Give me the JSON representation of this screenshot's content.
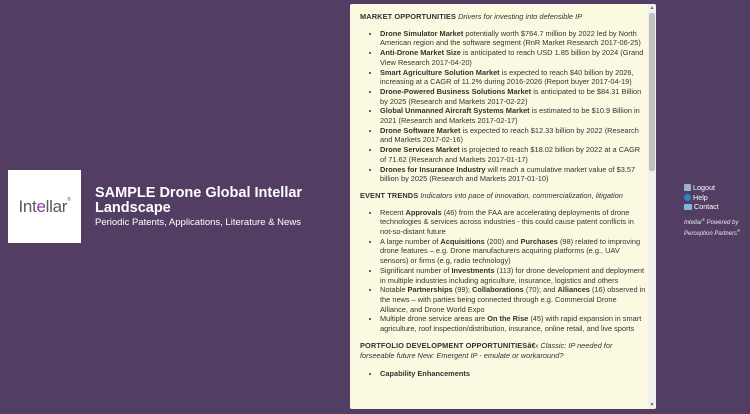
{
  "brand": {
    "logo_prefix": "Int",
    "logo_o": "e",
    "logo_suffix": "llar",
    "logo_mark": "®"
  },
  "header": {
    "title": "SAMPLE Drone Global Intellar Landscape",
    "subtitle": "Periodic Patents, Applications, Literature & News"
  },
  "panel": {
    "sections": [
      {
        "title": "MARKET OPPORTUNITIES",
        "subtitle": "Drivers for investing into defensible IP",
        "items": [
          {
            "bold": "Drone Simulator Market",
            "rest": " potentially worth $764.7 million by 2022 led by North American region and the software segment (RnR Market Research 2017-06-25)"
          },
          {
            "bold": "Anti-Drone Market Size",
            "rest": " is anticipated to reach USD 1.85 billion by 2024 (Grand View Research 2017-04-20)"
          },
          {
            "bold": "Smart Agriculture Solution Market",
            "rest": " is expected to reach $40 billion by 2026, increasing at a CAGR of 11.2% during 2016-2026 (Report buyer 2017-04-19)"
          },
          {
            "bold": "Drone-Powered Business Solutions Market",
            "rest": " is anticipated to be $84.31 Billion by 2025 (Research and Markets 2017-02-22)"
          },
          {
            "bold": "Global Unmanned Aircraft Systems Market",
            "rest": " is estimated to be $10.9 Billion in 2021 (Research and Markets 2017-02-17)"
          },
          {
            "bold": "Drone Software Market",
            "rest": " is expected to reach $12.33 billion by 2022 (Research and Markets 2017-02-16)"
          },
          {
            "bold": "Drone Services Market",
            "rest": " is projected to reach $18.02 billion by 2022 at a CAGR of 71.62 (Research and Markets 2017-01-17)"
          },
          {
            "bold": "Drones for Insurance Industry",
            "rest": " will reach a cumulative market value of $3.57 billion by 2025 (Research and Markets 2017-01-10)"
          }
        ]
      },
      {
        "title": "EVENT TRENDS",
        "subtitle": "Indicators into pace of innovation, commercialization, litigation",
        "items": [
          {
            "parts": [
              [
                "",
                "Recent "
              ],
              [
                "b",
                "Approvals"
              ],
              [
                "",
                " (46) from the FAA are accelerating deployments of drone technologies & services across industries - this could cause patent conflicts in not-so-distant future"
              ]
            ]
          },
          {
            "parts": [
              [
                "",
                "A large number of "
              ],
              [
                "b",
                "Acquisitions"
              ],
              [
                "",
                " (200) and "
              ],
              [
                "b",
                "Purchases"
              ],
              [
                "",
                " (98) related to improving drone features – e.g. Drone manufacturers acquiring platforms (e.g., UAV sensors) or firms (e.g, radio technology)"
              ]
            ]
          },
          {
            "parts": [
              [
                "",
                "Significant number of "
              ],
              [
                "b",
                "Investments"
              ],
              [
                "",
                " (113) for drone development and deployment in multiple industries including agriculture, insurance, logistics and others"
              ]
            ]
          },
          {
            "parts": [
              [
                "",
                "Notable "
              ],
              [
                "b",
                "Partnerships"
              ],
              [
                "",
                " (99); "
              ],
              [
                "b",
                "Collaborations"
              ],
              [
                "",
                " (70); and "
              ],
              [
                "b",
                "Alliances"
              ],
              [
                "",
                " (16) observed in the news – with parties being connected through e.g. Commercial Drone Alliance, and Drone World Expo"
              ]
            ]
          },
          {
            "parts": [
              [
                "",
                "Multiple drone service areas are "
              ],
              [
                "b",
                "On the Rise"
              ],
              [
                "",
                " (45) with rapid expansion in smart agriculture, roof inspection/distribution, insurance, online retail, and live sports"
              ]
            ]
          }
        ]
      },
      {
        "title": "PORTFOLIO DEVELOPMENT OPPORTUNITIESâ€‹",
        "subtitle": "Classic: IP needed for forseeable future New: Emergent IP - emulate or workaround?"
      }
    ],
    "next_heading": "Capability Enhancements"
  },
  "links": {
    "logout": "Logout",
    "help": "Help",
    "contact": "Contact",
    "powered_line1": "Intellar",
    "powered_reg": "®",
    "powered_line2": " Powered by",
    "powered_line3": "Perception Partners",
    "powered_reg2": "®"
  },
  "scroll": {
    "up_icon": "▲",
    "down_icon": "▼",
    "position_fraction": 0.0
  }
}
